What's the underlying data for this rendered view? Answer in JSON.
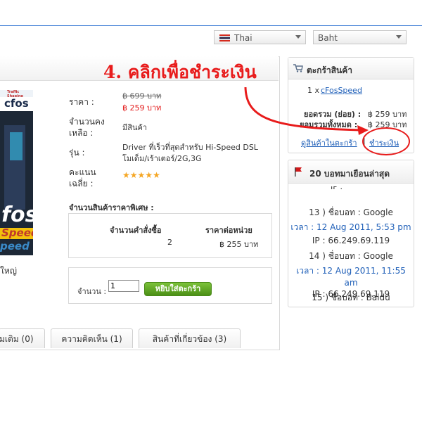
{
  "header": {
    "language": "Thai",
    "currency": "Baht",
    "thai_flag_colors": [
      "#d52b1e",
      "#ffffff",
      "#2d2a4a"
    ]
  },
  "callout": {
    "text": "4. คลิกเพื่อชำระเงิน",
    "color": "#e81b1b"
  },
  "product": {
    "image_text": {
      "tagline": "Traffic Shaping",
      "brand_small": "cfos",
      "brand_big": "fos",
      "speed": "Speed",
      "speed2": "peed"
    },
    "price_label": "ราคา :",
    "old_price": "฿ 699 บาท",
    "new_price": "฿ 259 บาท",
    "stock_label": "จำนวนคงเหลือ :",
    "stock_label_line1": "จำนวนคง",
    "stock_label_line2": "เหลือ :",
    "stock_value": "มีสินค้า",
    "model_label": "รุ่น :",
    "model_line1": "Driver ที่เร็วที่สุดสำหรับ Hi-Speed DSL",
    "model_line2": "โมเด็ม/เร้าเตอร์/2G,3G",
    "rating_label_line1": "คะแนน",
    "rating_label_line2": "เฉลี่ย :",
    "rating": 5,
    "rating_max": 5,
    "enlarge_fragment": "ใหญ่",
    "special_title": "จำนวนสินค้าราคาพิเศษ :",
    "special_table": {
      "headers": [
        "จำนวนคำสั่งซื้อ",
        "ราคาต่อหน่วย"
      ],
      "rows": [
        [
          "2",
          "฿ 255 บาท"
        ]
      ]
    },
    "qty_label": "จำนวน :",
    "qty_value": "1",
    "add_to_cart": "หยิบใส่ตะกร้า"
  },
  "tabs": [
    "่มเติม (0)",
    "ความคิดเห็น (1)",
    "สินค้าที่เกี่ยวข้อง (3)"
  ],
  "cart": {
    "title": "ตะกร้าสินค้า",
    "item_qty": "1 x",
    "item_name": "cFosSpeed",
    "subtotal_label": "ยอดรวม (ย่อย) :",
    "subtotal_value": "฿ 259 บาท",
    "total_label": "ยอมรวมทั้งหมด :",
    "total_value": "฿ 259 บาท",
    "view_cart": "ดูสินค้าในตะกร้า",
    "separator": "|",
    "checkout": "ชำระเงิน"
  },
  "visitors": {
    "title": "20 บอทมาเยือนล่าสุด",
    "entries": [
      {
        "name": "13 ) ชื่อบอท : Google",
        "time": "เวลา : 12 Aug 2011, 5:53 pm",
        "ip": "IP : 66.249.69.119"
      },
      {
        "name": "14 ) ชื่อบอท : Google",
        "time": "เวลา : 12 Aug 2011, 11:55 am",
        "ip": "IP : 66.249.69.119"
      }
    ],
    "partial_bottom": "15 ) ชื่อบอท : Baidu"
  }
}
